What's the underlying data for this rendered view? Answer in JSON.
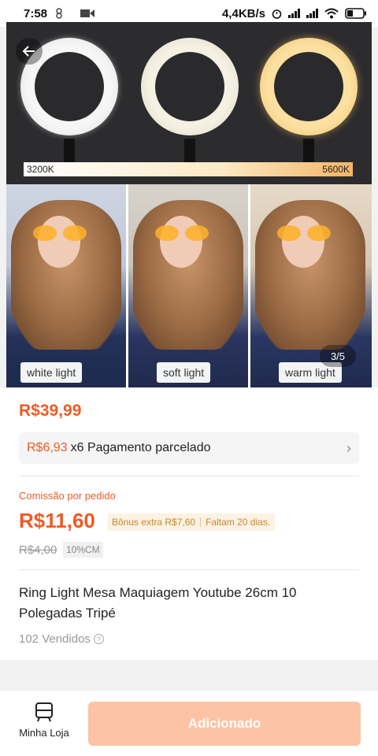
{
  "status_bar": {
    "time": "7:58",
    "network_speed": "4,4KB/s"
  },
  "gallery": {
    "temp_left": "3200K",
    "temp_right": "5600K",
    "labels": [
      "white light",
      "soft light",
      "warm light"
    ],
    "counter": "3/5"
  },
  "product": {
    "price": "R$39,99",
    "installment_amount": "R$6,93",
    "installment_text": "x6 Pagamento parcelado",
    "commission_label": "Comissão por pedido",
    "commission": "R$11,60",
    "bonus": "Bônus extra R$7,60",
    "days_left": "Faltam 20 dias.",
    "old_commission": "R$4,00",
    "commission_rate": "10%CM",
    "title": "Ring Light Mesa Maquiagem Youtube 26cm 10 Polegadas  Tripé",
    "sold": "102 Vendidos"
  },
  "bottom_bar": {
    "store_label": "Minha Loja",
    "add_label": "Adicionado"
  },
  "colors": {
    "accent": "#f05a24",
    "button_disabled": "#fcc3a4"
  }
}
